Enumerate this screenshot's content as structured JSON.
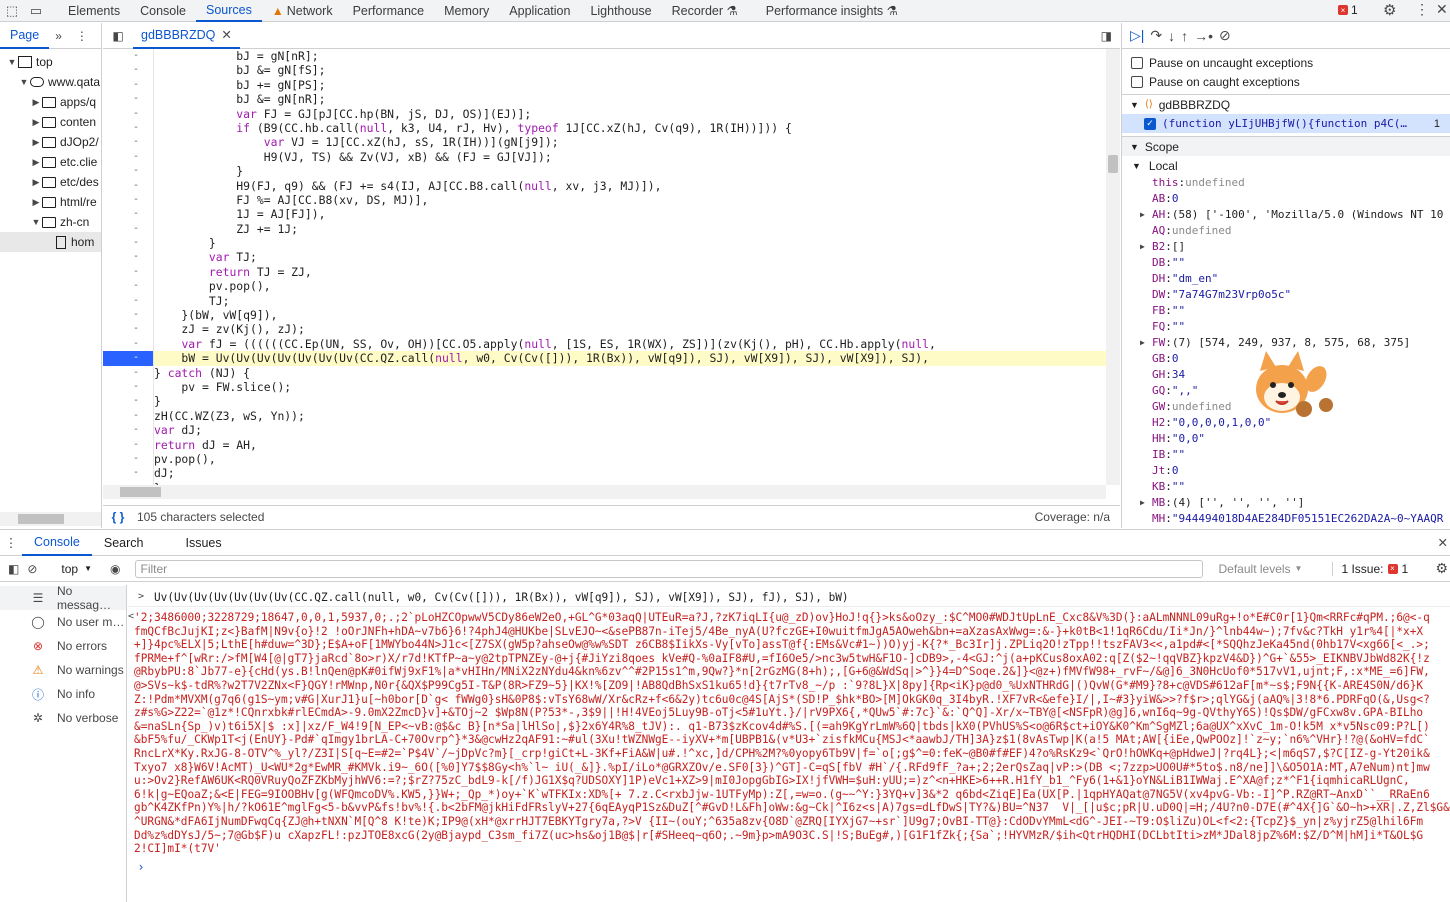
{
  "top_tabs": [
    "Elements",
    "Console",
    "Sources",
    "Network",
    "Performance",
    "Memory",
    "Application",
    "Lighthouse",
    "Recorder",
    "Performance insights"
  ],
  "issues_count": "1",
  "navigator": {
    "tab": "Page",
    "rows": [
      "top",
      "www.qata",
      "apps/q",
      "conten",
      "dJOp2/",
      "etc.clie",
      "etc/des",
      "html/re",
      "zh-cn",
      "hom"
    ]
  },
  "editor": {
    "file_tab": "gdBBBRZDQ",
    "status": "105 characters selected",
    "coverage": "Coverage: n/a",
    "lines": [
      "            bJ = gN[nR];",
      "            bJ &= gN[fS];",
      "            bJ += gN[PS];",
      "            bJ &= gN[nR];",
      "            var FJ = GJ[pJ[CC.hp(BN, jS, DJ, OS)](EJ)];",
      "            if (B9(CC.hb.call(null, k3, U4, rJ, Hv), typeof 1J[CC.xZ(hJ, Cv(q9), 1R(IH))])) {",
      "                var VJ = 1J[CC.xZ(hJ, sS, 1R(IH))](gN[j9]);",
      "                H9(VJ, TS) && Zv(VJ, xB) && (FJ = GJ[VJ]);",
      "            }",
      "            H9(FJ, q9) && (FJ += s4(IJ, AJ[CC.B8.call(null, xv, j3, MJ)]),",
      "            FJ %= AJ[CC.B8(xv, DS, MJ)],",
      "            1J = AJ[FJ]),",
      "            ZJ += 1J;",
      "        }",
      "        var TJ;",
      "        return TJ = ZJ,",
      "        pv.pop(),",
      "        TJ;",
      "    }(bW, vW[q9]),",
      "    zJ = zv(Kj(), zJ);",
      "    var fJ = ((((((CC.Ep(UN, SS, Ov, OH))[CC.O5.apply(null, [1S, ES, 1R(WX), ZS])](zv(Kj(), pH), CC.Hb.apply(null,",
      "    bW = Uv(Uv(Uv(Uv(Uv(Uv(Uv(CC.QZ.call(null, w0, Cv(Cv([])), 1R(Bx)), vW[q9]), SJ), vW[X9]), SJ), vW[X9]), SJ),",
      "} catch (NJ) {",
      "    pv = FW.slice();",
      "}",
      "zH(CC.WZ(Z3, wS, Yn));",
      "var dJ;",
      "return dJ = AH,",
      "pv.pop(),",
      "dJ;",
      "};"
    ]
  },
  "debugger": {
    "pause_uncaught": "Pause on uncaught exceptions",
    "pause_caught": "Pause on caught exceptions",
    "breakpoint_file": "gdBBBRZDQ",
    "breakpoint_code": "(function yLIjUHBjfW(){function p4C(…",
    "breakpoint_line": "1",
    "scope": "Scope",
    "local": "Local",
    "vars": [
      {
        "k": "this",
        "v": "undefined",
        "t": "und",
        "exp": false
      },
      {
        "k": "AB",
        "v": "0",
        "t": "num",
        "exp": false
      },
      {
        "k": "AH",
        "v": "(58) ['-100', 'Mozilla/5.0 (Windows NT 10",
        "t": "obj",
        "exp": true
      },
      {
        "k": "AQ",
        "v": "undefined",
        "t": "und",
        "exp": false
      },
      {
        "k": "B2",
        "v": "[]",
        "t": "obj",
        "exp": true
      },
      {
        "k": "DB",
        "v": "\"\"",
        "t": "str",
        "exp": false
      },
      {
        "k": "DH",
        "v": "\"dm_en\"",
        "t": "str",
        "exp": false
      },
      {
        "k": "DW",
        "v": "\"7a74G7m23Vrp0o5c\"",
        "t": "str",
        "exp": false
      },
      {
        "k": "FB",
        "v": "\"\"",
        "t": "str",
        "exp": false
      },
      {
        "k": "FQ",
        "v": "\"\"",
        "t": "str",
        "exp": false
      },
      {
        "k": "FW",
        "v": "(7) [574, 249, 937, 8, 575, 68, 375]",
        "t": "obj",
        "exp": true
      },
      {
        "k": "GB",
        "v": "0",
        "t": "num",
        "exp": false
      },
      {
        "k": "GH",
        "v": "34",
        "t": "num",
        "exp": false
      },
      {
        "k": "GQ",
        "v": "\",,\"",
        "t": "str",
        "exp": false
      },
      {
        "k": "GW",
        "v": "undefined",
        "t": "und",
        "exp": false
      },
      {
        "k": "H2",
        "v": "\"0,0,0,0,1,0,0\"",
        "t": "str",
        "exp": false
      },
      {
        "k": "HH",
        "v": "\"0,0\"",
        "t": "str",
        "exp": false
      },
      {
        "k": "IB",
        "v": "\"\"",
        "t": "str",
        "exp": false
      },
      {
        "k": "Jt",
        "v": "0",
        "t": "num",
        "exp": false
      },
      {
        "k": "KB",
        "v": "\"\"",
        "t": "str",
        "exp": false
      },
      {
        "k": "MB",
        "v": "(4) ['', '', '', '']",
        "t": "obj",
        "exp": true
      },
      {
        "k": "MH",
        "v": "\"944494018D4AE284DF05151EC262DA2A~0~YAAQR",
        "t": "str",
        "exp": false
      }
    ]
  },
  "drawer": {
    "tabs": [
      "Console",
      "Search",
      "Issues"
    ],
    "context": "top",
    "filter_placeholder": "Filter",
    "levels": "Default levels",
    "issue_label": "1 Issue:",
    "issue_count": "1"
  },
  "console_sidebar": [
    "No messag…",
    "No user m…",
    "No errors",
    "No warnings",
    "No info",
    "No verbose"
  ],
  "console": {
    "input": "Uv(Uv(Uv(Uv(Uv(Uv(Uv(CC.QZ.call(null, w0, Cv(Cv([])), 1R(Bx)), vW[q9]), SJ), vW[X9]), SJ), fJ), SJ), bW)",
    "output": [
      "'2;3486000;3228729;18647,0,0,1,5937,0;.;2`pLoHZCOpwwV5CDy86eW2eO,+GL^G*03aqQ|UTEuR=a?J,?zK7iqLI{u@_zD)ov}HoJ!q{}>ks&oOzy_:$C^MO0#WDJtUpLnE_Cxc8&V%3D(}:aALmNNNL09uRg+!o*E#C0r[1}Qm<RRFc#qPM.;6@<-q",
      "fmQCfBcJujKI;z<}BafM|N9v{o}!2 !oOrJNFh+hDA~v7b6}6!?4phJ4@HUKbe|SLvEJO~<&sePB87n-iTej5/4Be_nyA(U?fczGE+I0wuitfmJgA5AOweh&bn+=aXzasAxWwg=:&-}+k0tB<1!1qR6Cdu/Ii*Jn/}^lnb44w~);7fv&c?TkH y1r%4[|*x+X",
      "+]}4pc%ELX|5;LthE[h#duw=^3D};E$A+oF[1MWYbo44N>J1c<[Z7SX(gW5p?ahseOw@%w%SDT z6CB8$IikXs-Vy[vTo]assT@f{:EMs&Vc#1~))O)yj-K{?*_Bc3Ir]j.ZPLiq2O!zTpp!!tszFAV3<<,a1pd#<[*SQQhzJeKa45nd(0hb17V<xg66[<_.>;",
      "fPRMe+f^[wRr:/>fM[W4[@|gT7}jaRcd`8o>r)X/r7d!KTfP~a~y@2tpTPNZEy-@+j{#JiYzi8qoes kVe#Q-%0aIF8#U,=fI6Oe5/>nc3w5twH&F1O-]cDB9>,-4<GJ:^j(a+pKCus8oxA02:q[Z($2~!qqVBZ}kpzV4&D})^G+`&55>_EIKNBVJbWd82K{!z",
      "@RbybPU:8`Jb77-e}{cHd(ys.B!lnQen@pK#0ifWj9xF1%|a*vHIHn/MNiX2zNYdu4&kn%6zv^^#2P15s1^m,9Qw?}*n[2rGzMG(8+h);,[G+6@&WdSq|>^}}4=D^Soqe.2&]}<@z+)fMVfW98+_rvF~/&@]6_3N0HcUof0*517vV1,ujnt;F,:x*ME_=6]FW,",
      "@>SVs~k$-tdR%?w2T7V2ZNx<F}QGY!rMWnp,N0r{&QX$P99Cg5I-T&P(8R>FZ9~5}|KX!%[ZO9|!AB8QdBhSxS1ku65!d}{t7rTv8_~/p :`9?8L}X|8py]{Rp<iK}p@d0_%UxNTHRdG|()QvW(G*#M9}?8+c@VDS#612aF[m*~s$;F9N{{K-ARE4S0N/d6}K",
      "Z:!Pdm*MVXM(g7q6(g1S~ym;v#G|XurJ1}u[~h0bor[D`g< fWWg0}sH&0P8$:vTsY68wW/Xr&cRz+f<6&2y)tc6u0c@4S[AjS*(SD!P_$hk*BO>[M]OkGK0q_3I4byR.!XF7vR<&efe}I/|,I~#3}yiW&>>?f$r>;qlYG&j(aAQ%|3!8*6.PDRFqO(&,Usg<?",
      "z#s%G>Z22=`@1z*!CQnrxbk#rlECmdA>-9.0mX2ZmcD}v]+&TOj~2 $Wp8N(P?53*-,3$9||!H!4VEoj5Luy9B-oTj<5#1uYt.}/|rV9PX6{,*QUw5`#:7c}`&:`Q^Q]-Xr/x~TBY@[<NSFpR)@g]6,wnI6q~9g-QVthyY6S)!Qs$DW/gFCxw8v.GPA-BILho",
      "&=naSLn{Sp_)v)t6i5X|$ :x]|xz/F_W4!9[N_EP<~vB:@$&c B}[n*Sa|lHlSo|,$}2x6Y4R%8_tJV):. q1-B73$zKcov4d#%S.[(=ah9KgYrLmW%6Q|tbds|kX0(PVhUS%S<o@6R$ct+iOY&K0^Km^SgMZl;6a@UX^xXvC_1m-O!k5M x*v5Nsc09:P?L[)",
      "&bF5%fu/_CKWp1T<j(EnUY}-Pd#`qImgy1brLA-C+70Ovrp^}*3&@cwHz2qAF91:~#ul(3Xu!tWZNWgE--iyXV+*m[UBPB1&(v*U3+`zisfkMCu{MSJ<*aawbJ/TH]3A}z$1(8vAsTwp|K(a!5 MAt;AW[{iEe,QwPOOz]!`z~y;`n6%^VHr}!?@(&oHV=fdC`",
      "RncLrX*Ky.RxJG-8-OTV^%_yl?/Z3I|S[q~E=#2=`P$4V`/~jDpVc?m}[_crp!giCt+L-3Kf+FiA&W|u#.!^xc,]d/CPH%2M?%0yopy6Tb9V|f=`o[;g$^=0:feK~@B0#f#EF)4?o%RsKz9<`QrO!hOWKq+@pHdweJ|?rq4L};<|m6qS7,$?C[IZ-g-Yt20ik&",
      "Txyo7 x8}W6V!AcMT)_U<WU*2g*EwMR_#KMVk.i9~_6O([%0]Y7$$8Gy<h%`l~ iU(_&]}.%pI/iLo*@GRXZOv/e.SF0[3})^GT]-C=qS[fbV #H`/{.RFd9fF_?a+;2;2erQsZaq|vP:>(DB <;7zzp>UO0U#*5to$.n8/ne]]\\&O5O1A:MT,A7eNum)nt]mw",
      "u:>Ov2}RefAW6UK<RQ0VRuyQoZFZKbMyjhWV6:=?;$rZ?75zC_bdL9-k[/f)JG1X$q?UDSOXY]1P)eVc1+XZ>9|mI0JopgGbIG>IX!jfVWH=$uH:yUU;=)z^<n+HKE>6++R.H1fY_b1_^Fy6(1+&1}oYN&LiB1IWWaj.E^XA@f;z*^F1{iqmhicaRLUgnC,",
      "6!k|g~EQoaZ;&<E|FEG=9IOOBHv[g(WFQmcoDV%.KW5,}}W+;_Qp_*)oy+`K`wTFKIx:XD%[+ 7.z.C<rxbJjw-1UTFyMp):Z[,=w=o.(g~~^Y:}3YQ+v]3&*2 q6bd<ZiqE]Ea(UX[P.|1qpHYAQat@7NG5V(xv4pvG-Vb:-I]^P.RZ@RT~AnxD``__RRaEn6",
      "gb^K4ZKfPn)Y%|h/?kO61E^mglFg<5-b&vvP&fs!bv%!{.b<2bFM@jkHiFdFRslyV+27{6qEAyqP1Sz&DuZ[^#GvD!L&Fh]oWw:&g~Ck|^I6z<s|A)7gs=dLfDwS|TY?&)BU=^N37  V|_[|u$c;pR|U.uD0Q|=H;/4U?n0-D7E(#^4X{]G`&O~h>+XR|.Z,Zl$G&F^U",
      "^URGN&*dFA6IjNumDFwqCq{ZJ@h+tNXN`M[Q^8 K!te)K;IP9@(xH*@xrrHJT7EBKYTgry7a,?>V {II~(ouY;^635a8zv{O8D`@ZRQ[IYXjG7~+sr`]U9g7;OvBI-TT@}:CdODvYMmL<dG^-JEI-~T9:O$liZu)OL<f<2:{TcpZ}$_yn|z%yjrZ5@lhil6Fm",
      "Dd%z%dDYsJ/5~;7@Gb$F)u cXapzFL!:pzJTOE8xcG(2y@Bjaypd_C3sm_fi7Z(uc>hs&oj1B@$|r[#SHeeq~q6O;.~9m}p>mA9O3C.S|!S;BuEg#,)[G1F1fZk{;{Sa`;!HYVMzR/$ih<QtrHQDHI(DCLbtIti>zM*JDal8jpZ%6M:$Z/D^M|hM]i*T&OL$G",
      "2!CI]mI*(t7V'"
    ]
  }
}
